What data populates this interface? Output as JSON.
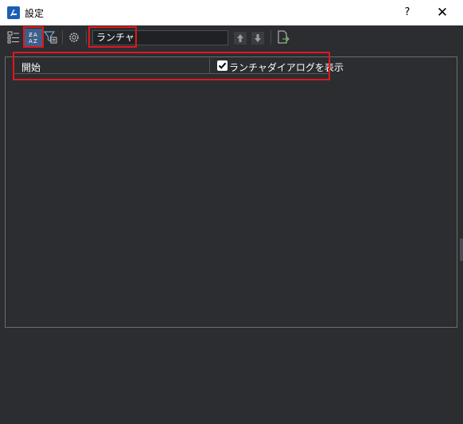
{
  "window": {
    "title": "設定",
    "help_label": "?",
    "close_label": "✕"
  },
  "toolbar": {
    "buttons": [
      {
        "name": "categorized-view",
        "icon": "tree-view-icon"
      },
      {
        "name": "alphabetical-sort",
        "icon": "sort-az-icon",
        "active": true
      },
      {
        "name": "filter",
        "icon": "filter-icon"
      },
      {
        "name": "settings",
        "icon": "gear-icon"
      },
      {
        "name": "previous",
        "icon": "arrow-up-icon"
      },
      {
        "name": "next",
        "icon": "arrow-down-icon"
      },
      {
        "name": "export",
        "icon": "export-document-icon"
      }
    ],
    "search_value": "ランチャ"
  },
  "results": {
    "row_label": "開始",
    "checkbox_label": "ランチャダイアログを表示",
    "checkbox_checked": true
  },
  "colors": {
    "highlight": "#e0181e",
    "background": "#2b2d30",
    "accent": "#1a5fb4"
  }
}
